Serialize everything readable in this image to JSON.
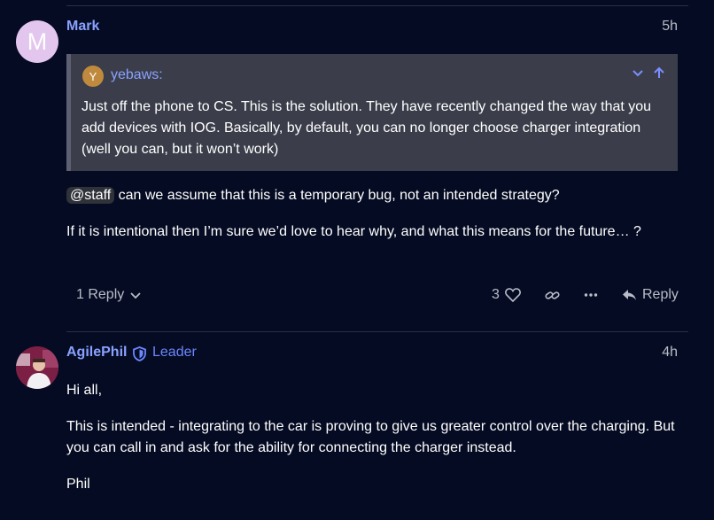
{
  "post1": {
    "avatar_letter": "M",
    "username": "Mark",
    "time": "5h",
    "quote": {
      "avatar_letter": "Y",
      "username": "yebaws:",
      "text": "Just off the phone to CS. This is the solution. They have recently changed the way that you add devices with IOG. Basically, by default, you can no longer choose charger integration (well you can, but it won’t work)"
    },
    "mention": "@staff",
    "line1_rest": " can we assume that this is a temporary bug, not an intended strategy?",
    "line2": "If it is intentional then I’m sure we’d love to hear why, and what this means for the future… ?",
    "replies_label": "1 Reply",
    "like_count": "3",
    "reply_label": "Reply"
  },
  "post2": {
    "username": "AgilePhil",
    "flair_title": "Leader",
    "time": "4h",
    "greeting": "Hi all,",
    "body": "This is intended - integrating to the car is proving to give us greater control over the charging. But you can call in and ask for the ability for connecting the charger instead.",
    "signoff": "Phil"
  },
  "colors": {
    "background": "#050b22",
    "username": "#8aa1ff",
    "quote_bg": "#3b3e4a",
    "muted": "#b9bdc9",
    "avatar_m": "#e3c6ee",
    "avatar_y": "#c08a3e"
  },
  "icons": [
    "chevron-down-icon",
    "arrow-up-icon",
    "heart-icon",
    "link-icon",
    "ellipsis-icon",
    "reply-arrow-icon",
    "shield-icon"
  ]
}
